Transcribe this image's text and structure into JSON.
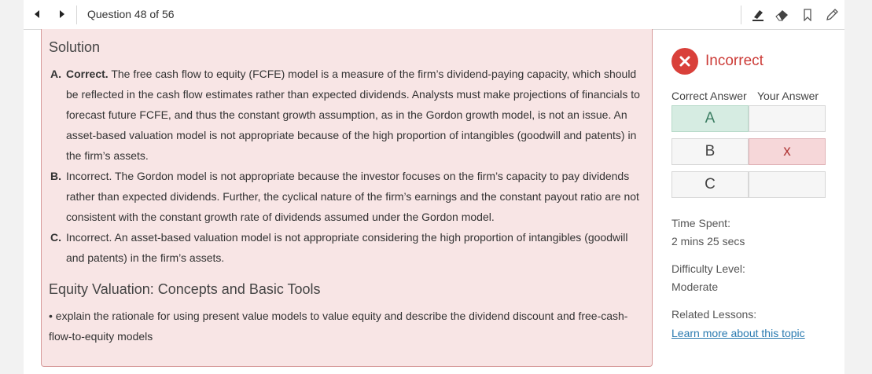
{
  "toolbar": {
    "question_counter": "Question 48 of 56",
    "icons": [
      "prev-arrow-icon",
      "next-arrow-icon",
      "highlighter-icon",
      "eraser-icon",
      "bookmark-icon",
      "pencil-icon"
    ]
  },
  "solution": {
    "title": "Solution",
    "answers": [
      {
        "letter": "A.",
        "verdict": "Correct.",
        "text": " The free cash flow to equity (FCFE) model is a measure of the firm’s dividend-paying capacity, which should be reflected in the cash flow estimates rather than expected dividends. Analysts must make projections of financials to forecast future FCFE, and thus the constant growth assumption, as in the Gordon growth model, is not an issue. An asset-based valuation model is not appropriate because of the high proportion of intangibles (goodwill and patents) in the firm’s assets."
      },
      {
        "letter": "B.",
        "verdict": "Incorrect.",
        "text": " The Gordon model is not appropriate because the investor focuses on the firm’s capacity to pay dividends rather than expected dividends. Further, the cyclical nature of the firm’s earnings and the constant payout ratio are not consistent with the constant growth rate of dividends assumed under the Gordon model."
      },
      {
        "letter": "C.",
        "verdict": "Incorrect.",
        "text": " An asset-based valuation model is not appropriate considering the high proportion of intangibles (goodwill and patents) in the firm’s assets."
      }
    ],
    "topic_title": "Equity Valuation: Concepts and Basic Tools",
    "objective": "• explain the rationale for using present value models to value equity and describe the dividend discount and free-cash-flow-to-equity models"
  },
  "result": {
    "status": "Incorrect",
    "correct_answer_header": "Correct Answer",
    "your_answer_header": "Your Answer",
    "rows": [
      {
        "option": "A",
        "mark": ""
      },
      {
        "option": "B",
        "mark": "x"
      },
      {
        "option": "C",
        "mark": ""
      }
    ],
    "time_spent_label": "Time Spent:",
    "time_spent_value": "2 mins 25 secs",
    "difficulty_label": "Difficulty Level:",
    "difficulty_value": "Moderate",
    "related_label": "Related Lessons:",
    "related_link": "Learn more about this topic"
  },
  "colors": {
    "solution_bg": "#f8e5e5",
    "solution_border": "#d79a9a",
    "incorrect_red": "#d9403a",
    "correct_green_bg": "#d6ece2",
    "wrong_red_bg": "#f6d7d9",
    "link_blue": "#2a7ab0"
  }
}
